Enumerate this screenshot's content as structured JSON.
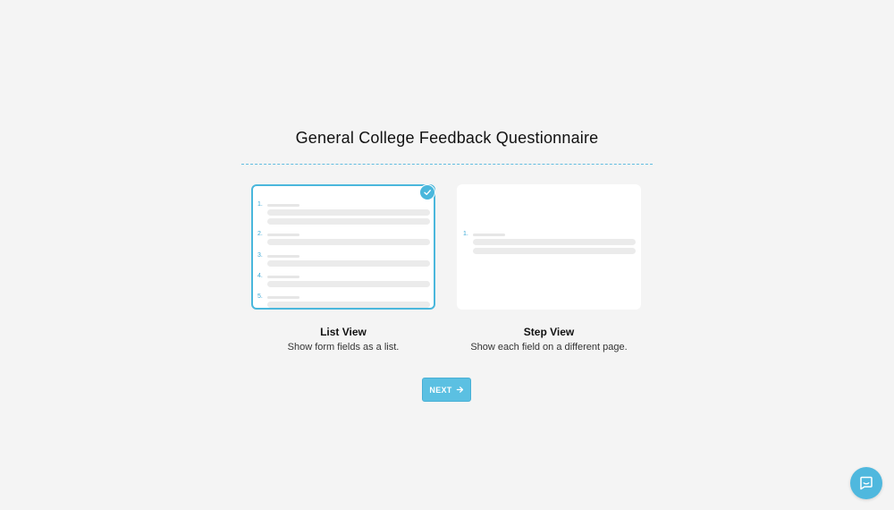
{
  "page": {
    "title": "General College Feedback Questionnaire",
    "accent_color": "#4ab7dc"
  },
  "options": [
    {
      "id": "list",
      "title": "List View",
      "description": "Show form fields as a list.",
      "selected": true,
      "preview_numbers": [
        "1.",
        "2.",
        "3.",
        "4.",
        "5."
      ]
    },
    {
      "id": "step",
      "title": "Step View",
      "description": "Show each field on a different page.",
      "selected": false,
      "preview_numbers": [
        "1."
      ]
    }
  ],
  "next_button": {
    "label": "NEXT",
    "icon": "arrow-right-icon"
  },
  "chat": {
    "icon": "chat-bubble-icon"
  }
}
